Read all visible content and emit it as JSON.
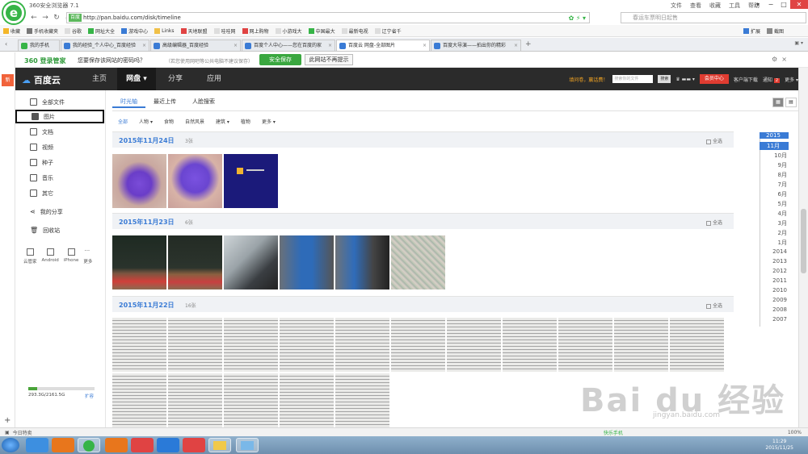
{
  "browser": {
    "title": "360安全浏览器 7.1",
    "menu": [
      "文件",
      "查看",
      "收藏",
      "工具",
      "帮助"
    ],
    "url_site_tag": "百度",
    "url": "http://pan.baidu.com/disk/timeline",
    "search_placeholder": "春运车票明日起售",
    "favorites": [
      "收藏",
      "手机收藏夹",
      "谷歌",
      "网址大全",
      "游戏中心",
      "Links",
      "天地联盟",
      "哇哇网",
      "网上购物",
      "小游戏大",
      "中国最大",
      "最新电视",
      "辽宁省千"
    ],
    "fav_right": [
      "扩展",
      "截图"
    ],
    "tabs": [
      {
        "label": "我的手机",
        "active": false
      },
      {
        "label": "我的经验_个人中心_百度经验",
        "active": false
      },
      {
        "label": "高级编辑器_百度经验",
        "active": false
      },
      {
        "label": "百度个人中心——您在百度的家",
        "active": false
      },
      {
        "label": "百度云 网盘-全部图片",
        "active": true
      },
      {
        "label": "百度大导演——拍出你的精彩",
        "active": false
      }
    ],
    "password_bar": {
      "brand": "360 登录管家",
      "message": "您要保存该网站的密码吗？",
      "tip": "（若您使用网吧等公共电脑不建议保存）",
      "save_label": "安全保存",
      "nosave_label": "此网站不再提示"
    },
    "left_new": "新"
  },
  "baidu": {
    "logo": "百度云",
    "nav": [
      "主页",
      "网盘",
      "分享",
      "应用"
    ],
    "header_right": {
      "link": "填问卷，赢话费！",
      "search_placeholder": "搜索你的文件",
      "search_button": "搜索",
      "vip": "会员中心",
      "download": "客户端下载",
      "notice": "通知",
      "notice_count": "2",
      "more": "更多"
    },
    "sidebar": {
      "items": [
        "全部文件",
        "图片",
        "文档",
        "视频",
        "种子",
        "音乐",
        "其它"
      ],
      "share": "我的分享",
      "recycle": "回收站",
      "devices": [
        "云管家",
        "Android",
        "iPhone",
        "更多"
      ],
      "quota_text": "293.3G/2161.5G",
      "quota_fraction": 0.136,
      "expand": "扩容"
    },
    "main_tabs": [
      "时光轴",
      "最近上传",
      "人脸搜索"
    ],
    "filters": [
      "全部",
      "人物",
      "食物",
      "自然风景",
      "建筑",
      "植物",
      "更多"
    ],
    "groups": [
      {
        "date": "2015年11月24日",
        "count": "3张",
        "select_all": "全选"
      },
      {
        "date": "2015年11月23日",
        "count": "6张",
        "select_all": "全选"
      },
      {
        "date": "2015年11月22日",
        "count": "16张",
        "select_all": "全选"
      }
    ],
    "timeline": [
      "2015",
      "11月",
      "10月",
      "9月",
      "8月",
      "7月",
      "6月",
      "5月",
      "4月",
      "3月",
      "2月",
      "1月",
      "2014",
      "2013",
      "2012",
      "2011",
      "2010",
      "2009",
      "2008",
      "2007"
    ]
  },
  "statusbar": {
    "left": "今日特卖",
    "right": [
      "快乐手机",
      "100%"
    ]
  },
  "taskbar": {
    "time": "11:29",
    "date": "2015/11/25"
  },
  "watermark": {
    "text": "Bai du 经验",
    "sub": "jingyan.baidu.com"
  },
  "colors": {
    "accent": "#3a7bd5",
    "header_bg": "#2b2b2b",
    "vip_red": "#e03c31"
  }
}
